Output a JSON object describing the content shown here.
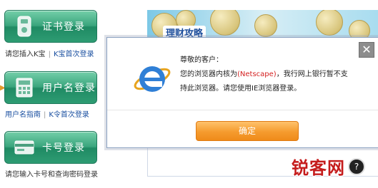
{
  "left": {
    "cert_login": {
      "label": "证书登录"
    },
    "cert_hint": {
      "text": "请您插入K宝",
      "link": "K宝首次登录"
    },
    "user_login": {
      "label": "用户名登录"
    },
    "user_links": {
      "guide": "用户名指南",
      "first": "K令首次登录"
    },
    "card_login": {
      "label": "卡号登录"
    },
    "card_hint": {
      "text": "请您输入卡号和查询密码登录"
    }
  },
  "background": {
    "banner_title": "理财攻略"
  },
  "dialog": {
    "greeting": "尊敬的客户：",
    "msg_line1_pre": "您的浏览器内核为",
    "msg_engine": "(Netscape)",
    "msg_line1_post": "，我行网上银行暂不支",
    "msg_line2": "持此浏览器。请您使用IE浏览器登录。",
    "ok_label": "确定",
    "close_glyph": "✕"
  },
  "watermark": {
    "text": "锐客网",
    "badge": "?"
  },
  "colors": {
    "button_green": "#3aa57d",
    "ok_orange": "#f59b2e",
    "highlight_red": "#d42020",
    "link_blue": "#1a4fa0"
  }
}
